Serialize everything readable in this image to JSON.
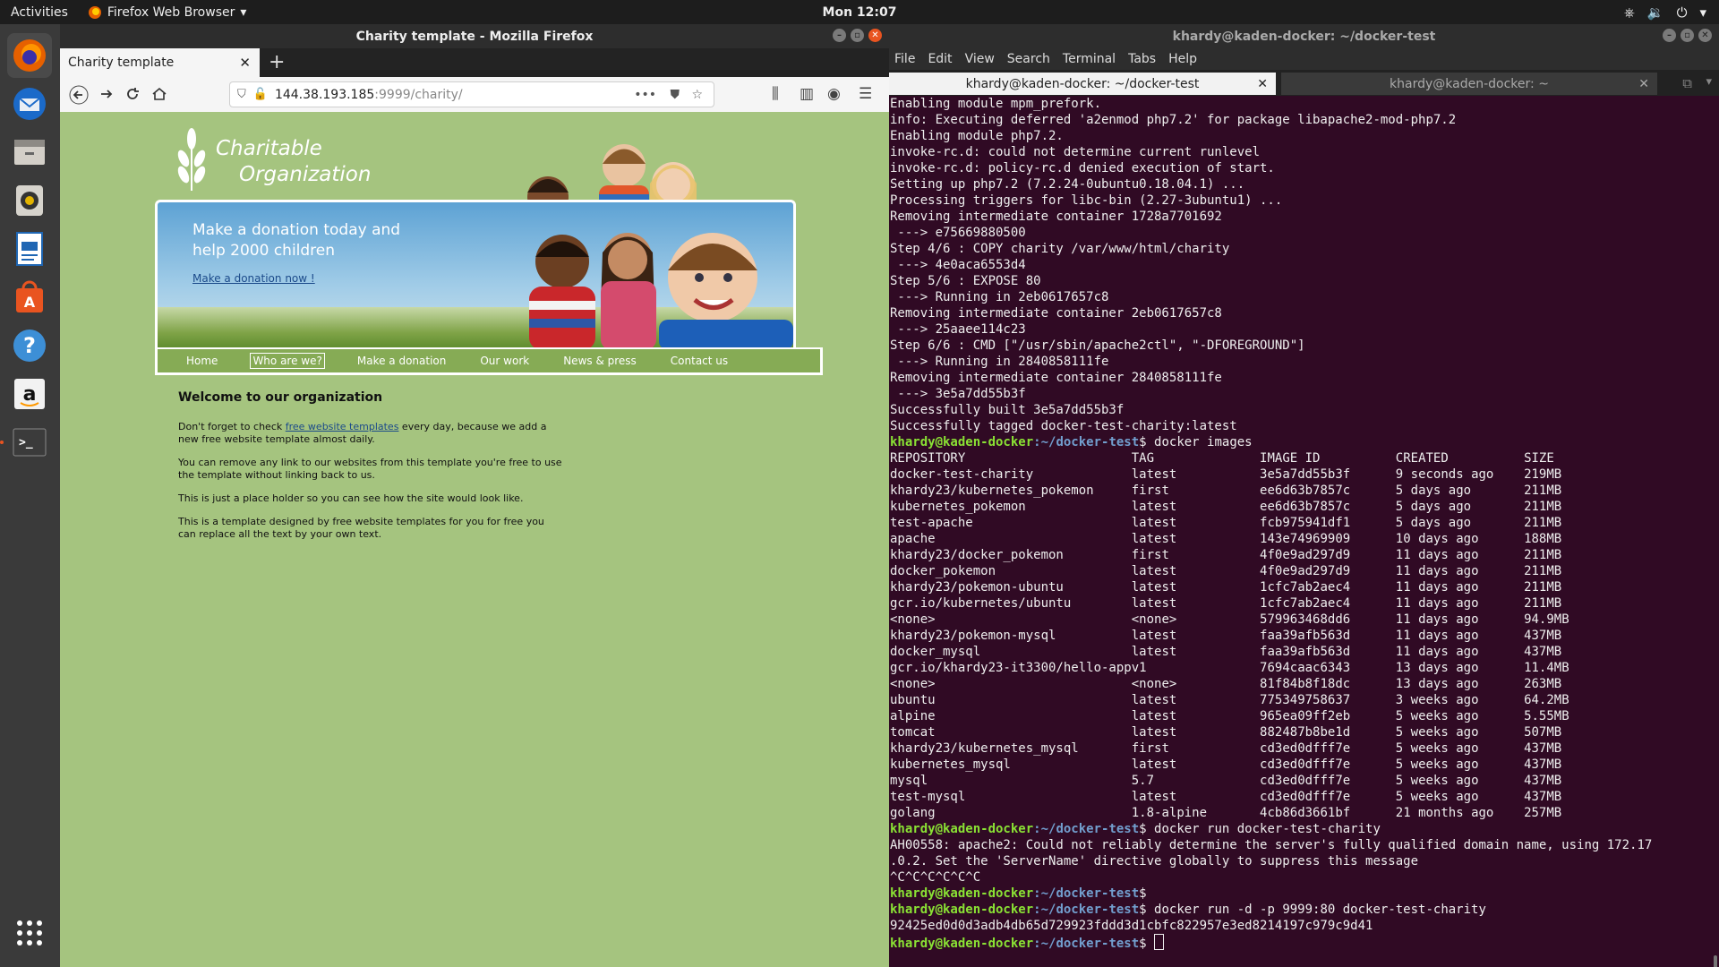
{
  "topbar": {
    "activities": "Activities",
    "app_name": "Firefox Web Browser",
    "clock": "Mon 12:07"
  },
  "dock": {
    "items": [
      "firefox-icon",
      "thunderbird-icon",
      "files-icon",
      "rhythmbox-icon",
      "writer-icon",
      "software-icon",
      "help-icon",
      "amazon-icon",
      "terminal-icon",
      "apps-grid-icon"
    ]
  },
  "firefox": {
    "window_title": "Charity template - Mozilla Firefox",
    "tab_title": "Charity template",
    "url_host": "144.38.193.185",
    "url_path": ":9999/charity/"
  },
  "charity": {
    "logo_line1": "Charitable",
    "logo_line2": "Organization",
    "banner_heading": "Make a donation today and help 2000 children",
    "banner_link": "Make a donation now !",
    "menu": [
      "Home",
      "Who are we?",
      "Make a donation",
      "Our work",
      "News & press",
      "Contact us"
    ],
    "welcome_title": "Welcome to our organization",
    "p1_before": "Don't forget to check ",
    "p1_link": "free website templates",
    "p1_after": " every day, because we add a new free website template almost daily.",
    "p2": "You can remove any link to our websites from this template you're free to use the template without linking back to us.",
    "p3": "This is just a place holder so you can see how the site would look like.",
    "p4": "This is a template designed by free website templates for you for free you can replace all the text by your own text."
  },
  "terminal": {
    "window_title": "khardy@kaden-docker: ~/docker-test",
    "menu": [
      "File",
      "Edit",
      "View",
      "Search",
      "Terminal",
      "Tabs",
      "Help"
    ],
    "tab1": "khardy@kaden-docker: ~/docker-test",
    "tab2": "khardy@kaden-docker: ~",
    "prompt_user": "khardy@kaden-docker",
    "prompt_path": ":~/docker-test",
    "lines_before": [
      "Enabling module mpm_prefork.",
      "info: Executing deferred 'a2enmod php7.2' for package libapache2-mod-php7.2",
      "Enabling module php7.2.",
      "invoke-rc.d: could not determine current runlevel",
      "invoke-rc.d: policy-rc.d denied execution of start.",
      "Setting up php7.2 (7.2.24-0ubuntu0.18.04.1) ...",
      "Processing triggers for libc-bin (2.27-3ubuntu1) ...",
      "Removing intermediate container 1728a7701692",
      " ---> e75669880500",
      "Step 4/6 : COPY charity /var/www/html/charity",
      " ---> 4e0aca6553d4",
      "Step 5/6 : EXPOSE 80",
      " ---> Running in 2eb0617657c8",
      "Removing intermediate container 2eb0617657c8",
      " ---> 25aaee114c23",
      "Step 6/6 : CMD [\"/usr/sbin/apache2ctl\", \"-DFOREGROUND\"]",
      " ---> Running in 2840858111fe",
      "Removing intermediate container 2840858111fe",
      " ---> 3e5a7dd55b3f",
      "Successfully built 3e5a7dd55b3f",
      "Successfully tagged docker-test-charity:latest"
    ],
    "cmd_images": "docker images",
    "table_header": [
      "REPOSITORY",
      "TAG",
      "IMAGE ID",
      "CREATED",
      "SIZE"
    ],
    "table_rows": [
      [
        "docker-test-charity",
        "latest",
        "3e5a7dd55b3f",
        "9 seconds ago",
        "219MB"
      ],
      [
        "khardy23/kubernetes_pokemon",
        "first",
        "ee6d63b7857c",
        "5 days ago",
        "211MB"
      ],
      [
        "kubernetes_pokemon",
        "latest",
        "ee6d63b7857c",
        "5 days ago",
        "211MB"
      ],
      [
        "test-apache",
        "latest",
        "fcb975941df1",
        "5 days ago",
        "211MB"
      ],
      [
        "apache",
        "latest",
        "143e74969909",
        "10 days ago",
        "188MB"
      ],
      [
        "khardy23/docker_pokemon",
        "first",
        "4f0e9ad297d9",
        "11 days ago",
        "211MB"
      ],
      [
        "docker_pokemon",
        "latest",
        "4f0e9ad297d9",
        "11 days ago",
        "211MB"
      ],
      [
        "khardy23/pokemon-ubuntu",
        "latest",
        "1cfc7ab2aec4",
        "11 days ago",
        "211MB"
      ],
      [
        "gcr.io/kubernetes/ubuntu",
        "latest",
        "1cfc7ab2aec4",
        "11 days ago",
        "211MB"
      ],
      [
        "<none>",
        "<none>",
        "579963468dd6",
        "11 days ago",
        "94.9MB"
      ],
      [
        "khardy23/pokemon-mysql",
        "latest",
        "faa39afb563d",
        "11 days ago",
        "437MB"
      ],
      [
        "docker_mysql",
        "latest",
        "faa39afb563d",
        "11 days ago",
        "437MB"
      ],
      [
        "gcr.io/khardy23-it3300/hello-app",
        "v1",
        "7694caac6343",
        "13 days ago",
        "11.4MB"
      ],
      [
        "<none>",
        "<none>",
        "81f84b8f18dc",
        "13 days ago",
        "263MB"
      ],
      [
        "ubuntu",
        "latest",
        "775349758637",
        "3 weeks ago",
        "64.2MB"
      ],
      [
        "alpine",
        "latest",
        "965ea09ff2eb",
        "5 weeks ago",
        "5.55MB"
      ],
      [
        "tomcat",
        "latest",
        "882487b8be1d",
        "5 weeks ago",
        "507MB"
      ],
      [
        "khardy23/kubernetes_mysql",
        "first",
        "cd3ed0dfff7e",
        "5 weeks ago",
        "437MB"
      ],
      [
        "kubernetes_mysql",
        "latest",
        "cd3ed0dfff7e",
        "5 weeks ago",
        "437MB"
      ],
      [
        "mysql",
        "5.7",
        "cd3ed0dfff7e",
        "5 weeks ago",
        "437MB"
      ],
      [
        "test-mysql",
        "latest",
        "cd3ed0dfff7e",
        "5 weeks ago",
        "437MB"
      ],
      [
        "golang",
        "1.8-alpine",
        "4cb86d3661bf",
        "21 months ago",
        "257MB"
      ]
    ],
    "cmd_run": "docker run docker-test-charity",
    "apache_msg1": "AH00558: apache2: Could not reliably determine the server's fully qualified domain name, using 172.17",
    "apache_msg2": ".0.2. Set the 'ServerName' directive globally to suppress this message",
    "ctrl_c": "^C^C^C^C^C^C",
    "cmd_run_d": "docker run -d -p 9999:80 docker-test-charity",
    "container_id": "92425ed0d0d3adb4db65d729923fddd3d1cbfc822957e3ed8214197c979c9d41"
  }
}
